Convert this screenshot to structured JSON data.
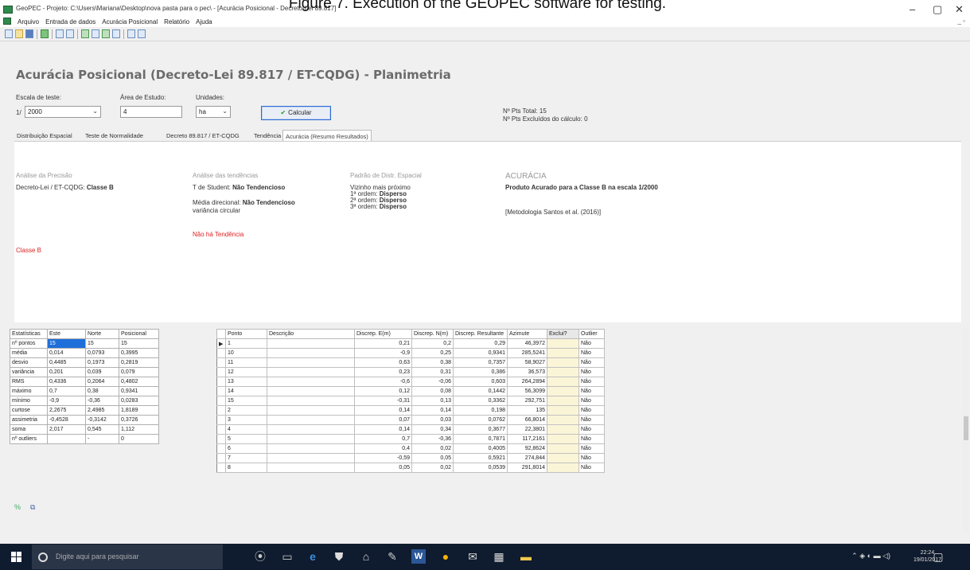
{
  "caption": "Figure 7. Execution of the GEOPEC software for testing.",
  "window": {
    "title": "GeoPEC - Projeto: C:\\Users\\Mariana\\Desktop\\nova pasta para o pec\\ - [Acurácia Posicional - Decreto-Lei 89.817]",
    "minimize": "–",
    "maximize": "▢",
    "close": "✕",
    "mdi_controls": "_ ▫"
  },
  "menu": [
    "Arquivo",
    "Entrada de dados",
    "Acurácia Posicional",
    "Relatório",
    "Ajuda"
  ],
  "form": {
    "title": "Acurácia Posicional (Decreto-Lei 89.817 / ET-CQDG) - Planimetria",
    "scale_label": "Escala de teste:",
    "scale_prefix": "1/",
    "scale_value": "2000",
    "area_label": "Área de Estudo:",
    "area_value": "4",
    "units_label": "Unidades:",
    "units_value": "ha",
    "calc_button": "Calcular",
    "total_pts": "Nº Pts Total: 15",
    "excluded_pts": "Nº Pts Excluídos do cálculo: 0"
  },
  "tabs": [
    "Distribuição Espacial",
    "Teste de Normalidade",
    "Decreto 89.817 / ET-CQDG",
    "Tendência",
    "Acurácia (Resumo Resultados)"
  ],
  "summary": {
    "precision_heading": "Análise da Precisão",
    "precision_line_prefix": "Decreto-Lei / ET-CQDG:",
    "precision_class": "Classe B",
    "precision_red": "Classe B",
    "trend_heading": "Análise das tendências",
    "trend_t_prefix": "T de Student:",
    "trend_t_value": "Não Tendencioso",
    "trend_mean_prefix": "Média direcional:",
    "trend_mean_value": "Não Tendencioso",
    "trend_var": "variância circular",
    "trend_red": "Não há Tendência",
    "pattern_heading": "Padrão de Distr. Espacial",
    "pattern_neighbor": "Vizinho mais próximo",
    "pattern_orders": [
      {
        "label": "1ª ordem:",
        "value": "Disperso"
      },
      {
        "label": "2ª ordem:",
        "value": "Disperso"
      },
      {
        "label": "3ª ordem:",
        "value": "Disperso"
      }
    ],
    "accuracy_heading": "ACURÁCIA",
    "accuracy_result": "Produto Acurado para a Classe B na escala 1/2000",
    "accuracy_method": "[Metodologia Santos et al. (2016)]"
  },
  "stats": {
    "headers": [
      "Estatísticas",
      "Este",
      "Norte",
      "Posicional"
    ],
    "rows": [
      [
        "nº pontos",
        "15",
        "15",
        "15"
      ],
      [
        "média",
        "0,014",
        "0,0793",
        "0,3995"
      ],
      [
        "desvio",
        "0,4485",
        "0,1973",
        "0,2819"
      ],
      [
        "variância",
        "0,201",
        "0,039",
        "0,079"
      ],
      [
        "RMS",
        "0,4336",
        "0,2064",
        "0,4802"
      ],
      [
        "máximo",
        "0,7",
        "0,38",
        "0,9341"
      ],
      [
        "mínimo",
        "-0,9",
        "-0,36",
        "0,0283"
      ],
      [
        "curtose",
        "2,2675",
        "2,4985",
        "1,8189"
      ],
      [
        "assimetria",
        "-0,4528",
        "-0,3142",
        "0,3726"
      ],
      [
        "soma",
        "2,017",
        "0,545",
        "1,112"
      ],
      [
        "nº outliers",
        "",
        "-",
        "0"
      ]
    ]
  },
  "data": {
    "headers": [
      "Ponto",
      "Descrição",
      "Discrep. E(m)",
      "Discrep. N(m)",
      "Discrep. Resultante",
      "Azimute",
      "Exclui?",
      "Outlier"
    ],
    "rows": [
      [
        "1",
        "",
        "0,21",
        "0,2",
        "0,29",
        "46,3972",
        "",
        "Não"
      ],
      [
        "10",
        "",
        "-0,9",
        "0,25",
        "0,9341",
        "285,5241",
        "",
        "Não"
      ],
      [
        "11",
        "",
        "0,63",
        "0,38",
        "0,7357",
        "58,9027",
        "",
        "Não"
      ],
      [
        "12",
        "",
        "0,23",
        "0,31",
        "0,386",
        "36,573",
        "",
        "Não"
      ],
      [
        "13",
        "",
        "-0,6",
        "-0,06",
        "0,603",
        "264,2894",
        "",
        "Não"
      ],
      [
        "14",
        "",
        "0,12",
        "0,08",
        "0,1442",
        "56,3099",
        "",
        "Não"
      ],
      [
        "15",
        "",
        "-0,31",
        "0,13",
        "0,3362",
        "292,751",
        "",
        "Não"
      ],
      [
        "2",
        "",
        "0,14",
        "0,14",
        "0,198",
        "135",
        "",
        "Não"
      ],
      [
        "3",
        "",
        "0,07",
        "0,03",
        "0,0762",
        "66,8014",
        "",
        "Não"
      ],
      [
        "4",
        "",
        "0,14",
        "0,34",
        "0,3677",
        "22,3801",
        "",
        "Não"
      ],
      [
        "5",
        "",
        "0,7",
        "-0,36",
        "0,7871",
        "117,2161",
        "",
        "Não"
      ],
      [
        "6",
        "",
        "0,4",
        "0,02",
        "0,4005",
        "92,8624",
        "",
        "Não"
      ],
      [
        "7",
        "",
        "-0,59",
        "0,05",
        "0,5921",
        "274,844",
        "",
        "Não"
      ],
      [
        "8",
        "",
        "0,05",
        "0,02",
        "0,0539",
        "291,8014",
        "",
        "Não"
      ]
    ]
  },
  "taskbar": {
    "search_placeholder": "Digite aqui para pesquisar",
    "time": "22:24",
    "date": "19/01/2017"
  }
}
